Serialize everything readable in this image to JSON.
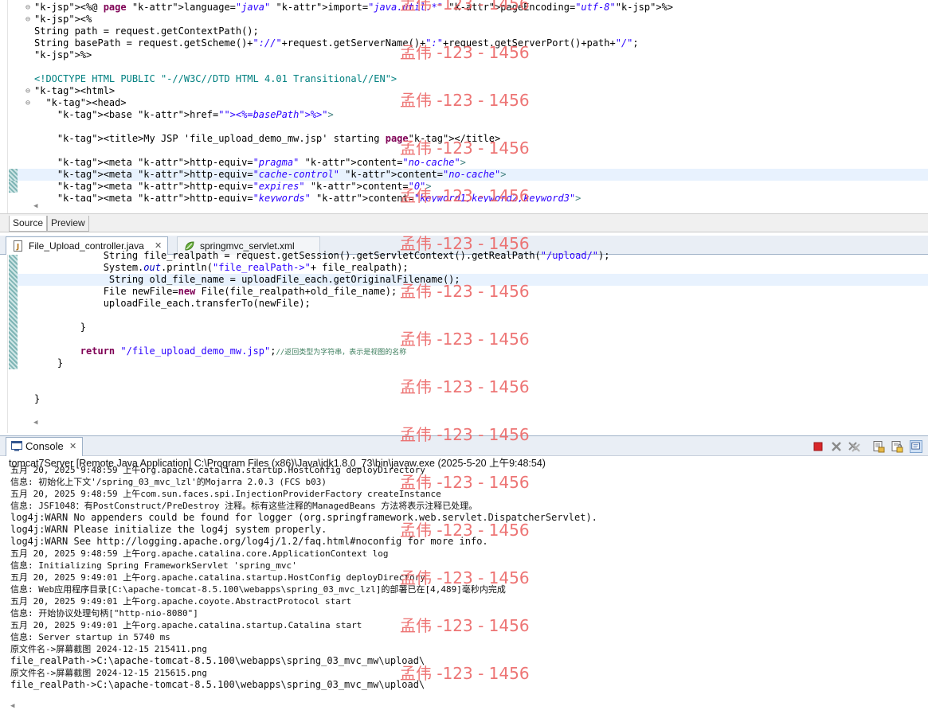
{
  "editor_jsp": {
    "lines": [
      "<%@ page language=\"java\" import=\"java.util.*\" pageEncoding=\"utf-8\"%>",
      "<%",
      "String path = request.getContextPath();",
      "String basePath = request.getScheme()+\"://\"+request.getServerName()+\":\"+request.getServerPort()+path+\"/\";",
      "%>",
      "",
      "<!DOCTYPE HTML PUBLIC \"-//W3C//DTD HTML 4.01 Transitional//EN\">",
      "<html>",
      "  <head>",
      "    <base href=\"<%=basePath%>\">",
      "",
      "    <title>My JSP 'file_upload_demo_mw.jsp' starting page</title>",
      "",
      "    <meta http-equiv=\"pragma\" content=\"no-cache\">",
      "    <meta http-equiv=\"cache-control\" content=\"no-cache\">",
      "    <meta http-equiv=\"expires\" content=\"0\">",
      "    <meta http-equiv=\"keywords\" content=\"keyword1,keyword2,keyword3\">"
    ]
  },
  "source_tabs": {
    "source": "Source",
    "preview": "Preview"
  },
  "editor_tabs": [
    {
      "label": "File_Upload_controller.java",
      "active": true
    },
    {
      "label": "springmvc_servlet.xml",
      "active": false
    }
  ],
  "editor_java": {
    "lines": [
      "            String file_realpath = request.getSession().getServletContext().getRealPath(\"/upload/\");",
      "            System.out.println(\"file_realPath->\"+ file_realpath);",
      "             String old_file_name = uploadFile_each.getOriginalFilename();",
      "            File newFile=new File(file_realpath+old_file_name);",
      "            uploadFile_each.transferTo(newFile);",
      "",
      "        }",
      "",
      "        return \"/file_upload_demo_mw.jsp\";//返回类型为字符串，表示是视图的名称",
      "    }",
      "",
      "",
      "}"
    ],
    "return_str": "\"/file_upload_demo_mw.jsp\"",
    "return_comment": "//返回类型为字符串，表示是视图的名称"
  },
  "console": {
    "tab_label": "Console",
    "title": "tomcat7Server [Remote Java Application] C:\\Program Files (x86)\\Java\\jdk1.8.0_73\\bin\\javaw.exe (2025-5-20 上午9:48:54)",
    "lines": [
      "五月 20, 2025 9:48:59 上午org.apache.catalina.startup.HostConfig deployDirectory",
      "信息: 初始化上下文'/spring_03_mvc_lzl'的Mojarra 2.0.3 (FCS b03)",
      "五月 20, 2025 9:48:59 上午com.sun.faces.spi.InjectionProviderFactory createInstance",
      "信息: JSF1048：有PostConstruct/PreDestroy 注释。标有这些注释的ManagedBeans 方法将表示注释已处理。",
      "log4j:WARN No appenders could be found for logger (org.springframework.web.servlet.DispatcherServlet).",
      "log4j:WARN Please initialize the log4j system properly.",
      "log4j:WARN See http://logging.apache.org/log4j/1.2/faq.html#noconfig for more info.",
      "五月 20, 2025 9:48:59 上午org.apache.catalina.core.ApplicationContext log",
      "信息: Initializing Spring FrameworkServlet 'spring_mvc'",
      "五月 20, 2025 9:49:01 上午org.apache.catalina.startup.HostConfig deployDirectory",
      "信息: Web应用程序目录[C:\\apache-tomcat-8.5.100\\webapps\\spring_03_mvc_lzl]的部署已在[4,489]毫秒内完成",
      "五月 20, 2025 9:49:01 上午org.apache.coyote.AbstractProtocol start",
      "信息: 开始协议处理句柄[\"http-nio-8080\"]",
      "五月 20, 2025 9:49:01 上午org.apache.catalina.startup.Catalina start",
      "信息: Server startup in 5740 ms",
      "原文件名->屏幕截图 2024-12-15 215411.png",
      "file_realPath->C:\\apache-tomcat-8.5.100\\webapps\\spring_03_mvc_mw\\upload\\",
      "原文件名->屏幕截图 2024-12-15 215615.png",
      "file_realPath->C:\\apache-tomcat-8.5.100\\webapps\\spring_03_mvc_mw\\upload\\"
    ]
  },
  "watermark": "孟伟 -123 - 1456",
  "colors": {
    "jsp_delim": "#bf5f3f",
    "keyword": "#7f0055",
    "tag": "#3f7f7f",
    "attr": "#7f007f",
    "string": "#2a00ff",
    "comment": "#3f7f5f",
    "watermark": "#ec6969",
    "current_line": "#e8f2fe"
  }
}
